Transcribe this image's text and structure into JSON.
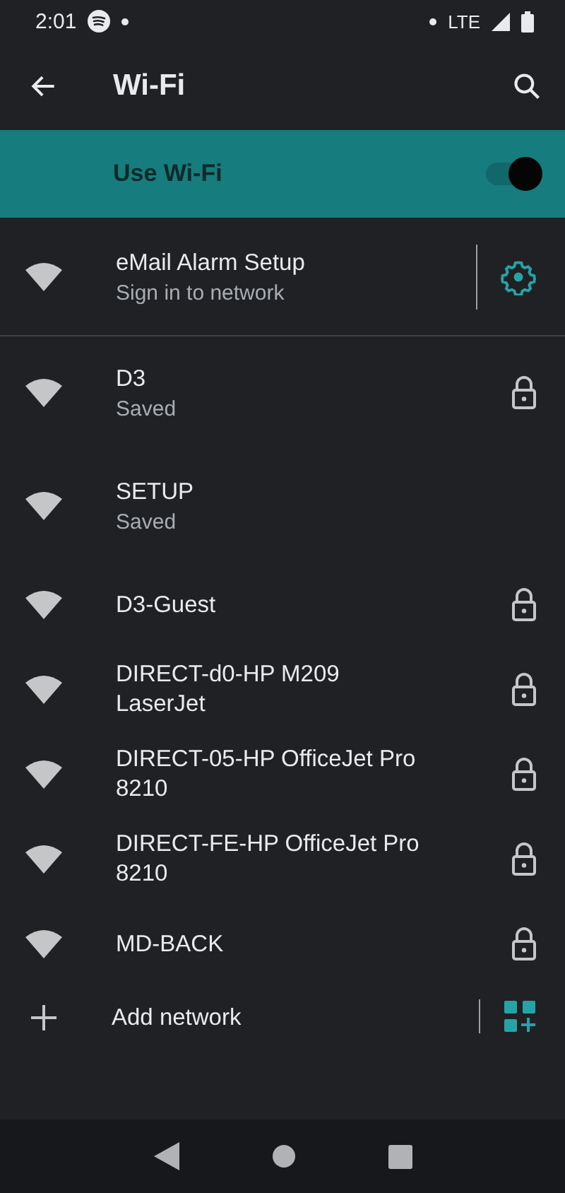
{
  "status_bar": {
    "time": "2:01",
    "network": "LTE"
  },
  "app_bar": {
    "title": "Wi-Fi"
  },
  "master_switch": {
    "label": "Use Wi-Fi",
    "on": true
  },
  "networks": [
    {
      "kind": "action",
      "name": "eMail Alarm Setup",
      "summary": "Sign in to network",
      "secured": false
    },
    {
      "kind": "plain",
      "name": "D3",
      "summary": "Saved",
      "secured": true
    },
    {
      "kind": "plain",
      "name": "SETUP",
      "summary": "Saved",
      "secured": false
    },
    {
      "kind": "plain",
      "name": "D3-Guest",
      "secured": true
    },
    {
      "kind": "plain",
      "name": "DIRECT-d0-HP M209 LaserJet",
      "secured": true
    },
    {
      "kind": "plain",
      "name": "DIRECT-05-HP OfficeJet Pro 8210",
      "secured": true
    },
    {
      "kind": "plain",
      "name": "DIRECT-FE-HP OfficeJet Pro 8210",
      "secured": true
    },
    {
      "kind": "plain",
      "name": "MD-BACK",
      "secured": true
    }
  ],
  "add_network": {
    "label": "Add network"
  }
}
